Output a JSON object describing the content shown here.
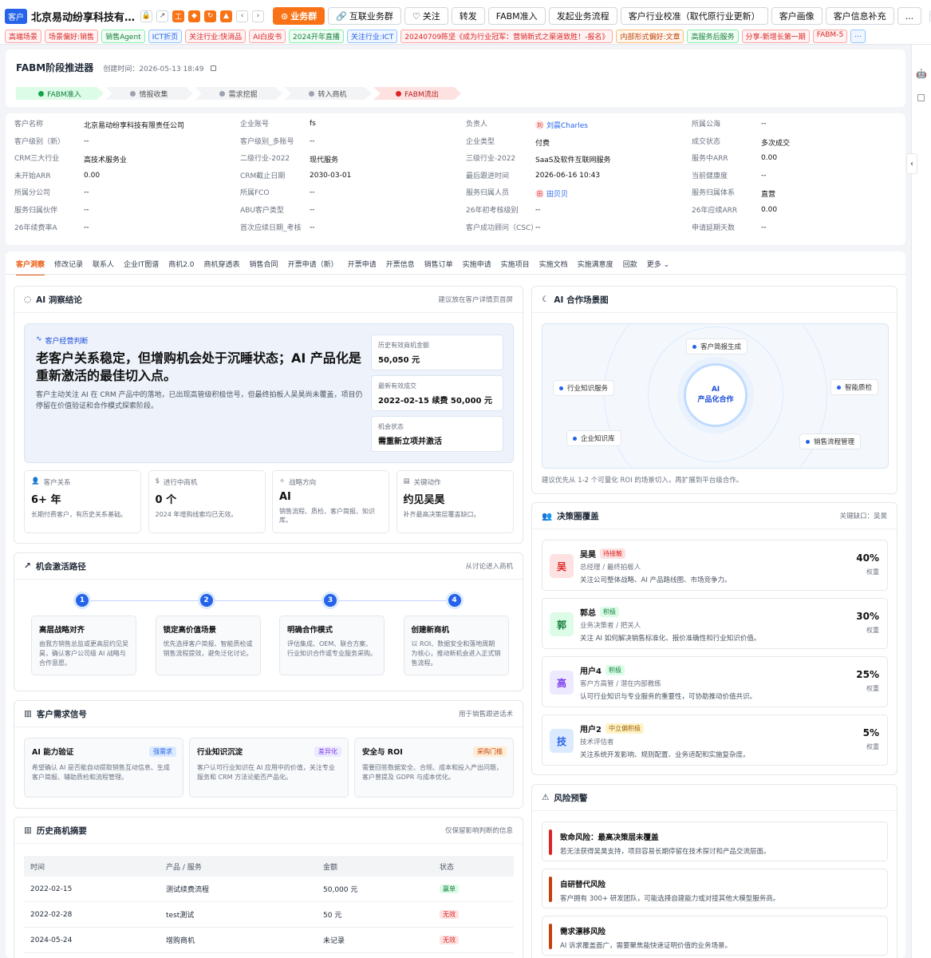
{
  "header": {
    "customer_tag": "客户",
    "company_title": "北京易动纷享科技有限责任公司",
    "icon_labels": [
      "工",
      "◆",
      "↻",
      "▲"
    ],
    "buttons": [
      {
        "label": "业务群",
        "primary": true,
        "icon": "users-icon"
      },
      {
        "label": "互联业务群",
        "icon": "link-icon"
      },
      {
        "label": "关注",
        "icon": "heart-icon"
      },
      {
        "label": "转发"
      },
      {
        "label": "FABM准入"
      },
      {
        "label": "发起业务流程"
      },
      {
        "label": "客户行业校准（取代原行业更新）"
      },
      {
        "label": "客户画像"
      },
      {
        "label": "客户信息补充"
      },
      {
        "label": "..."
      }
    ],
    "tags": [
      {
        "label": "高端场景",
        "c": "r"
      },
      {
        "label": "场景偏好:销售",
        "c": "r"
      },
      {
        "label": "销售Agent",
        "c": "g"
      },
      {
        "label": "ICT折页",
        "c": "b"
      },
      {
        "label": "关注行业:快消品",
        "c": "r"
      },
      {
        "label": "AI白皮书",
        "c": "r"
      },
      {
        "label": "2024开年直播",
        "c": "g"
      },
      {
        "label": "关注行业:ICT",
        "c": "b"
      },
      {
        "label": "20240709陈坚《成为行业冠军：营销新式之渠道致胜！-报名》",
        "c": "r"
      },
      {
        "label": "内部形式偏好:文章",
        "c": "o"
      },
      {
        "label": "高服务后服务",
        "c": "g"
      },
      {
        "label": "分享-新增长第一期",
        "c": "r"
      },
      {
        "label": "FABM-5",
        "c": "r"
      },
      {
        "label": "...",
        "c": "b"
      }
    ]
  },
  "stage": {
    "title": "FABM阶段推进器",
    "created": "创建时间：2026-05-13 18:49",
    "steps": [
      {
        "label": "FABM准入",
        "state": "done"
      },
      {
        "label": "情报收集",
        "state": "todo"
      },
      {
        "label": "需求挖掘",
        "state": "todo"
      },
      {
        "label": "转入商机",
        "state": "todo"
      },
      {
        "label": "FABM流出",
        "state": "out"
      }
    ]
  },
  "info": [
    {
      "label": "客户名称",
      "value": "北京易动纷享科技有限责任公司"
    },
    {
      "label": "企业账号",
      "value": "fs"
    },
    {
      "label": "负责人",
      "value": "刘晨Charles",
      "avatar": "刘",
      "link": true
    },
    {
      "label": "所属公海",
      "value": "--"
    },
    {
      "label": "客户级别（新）",
      "value": "--"
    },
    {
      "label": "客户级别_多账号",
      "value": "--"
    },
    {
      "label": "企业类型",
      "value": "付费"
    },
    {
      "label": "成交状态",
      "value": "多次成交"
    },
    {
      "label": "CRM三大行业",
      "value": "高技术服务业"
    },
    {
      "label": "二级行业-2022",
      "value": "现代服务"
    },
    {
      "label": "三级行业-2022",
      "value": "SaaS及软件互联网服务"
    },
    {
      "label": "服务中ARR",
      "value": "0.00"
    },
    {
      "label": "未开始ARR",
      "value": "0.00"
    },
    {
      "label": "CRM截止日期",
      "value": "2030-03-01"
    },
    {
      "label": "最后跟进时间",
      "value": "2026-06-16 10:43"
    },
    {
      "label": "当前健康度",
      "value": "--"
    },
    {
      "label": "所属分公司",
      "value": "--"
    },
    {
      "label": "所属FCO",
      "value": "--"
    },
    {
      "label": "服务归属人员",
      "value": "田贝贝",
      "avatar": "田",
      "link": true
    },
    {
      "label": "服务归属体系",
      "value": "直营"
    },
    {
      "label": "服务归属伙伴",
      "value": "--"
    },
    {
      "label": "ABU客户类型",
      "value": "--"
    },
    {
      "label": "26年初考核级别",
      "value": "--"
    },
    {
      "label": "26年应续ARR",
      "value": "0.00"
    },
    {
      "label": "26年续费率A",
      "value": "--"
    },
    {
      "label": "首次应续日期_考核",
      "value": "--"
    },
    {
      "label": "客户成功顾问（CSC）",
      "value": "--"
    },
    {
      "label": "申请延期天数",
      "value": "--"
    }
  ],
  "tabs": [
    "客户洞察",
    "修改记录",
    "联系人",
    "企业IT图谱",
    "商机2.0",
    "商机穿透表",
    "销售合同",
    "开票申请（新）",
    "开票申请",
    "开票信息",
    "销售订单",
    "实施申请",
    "实施项目",
    "实施文档",
    "实施满意度",
    "回款",
    "更多"
  ],
  "ai": {
    "title": "AI 洞察结论",
    "note": "建议放在客户详情页首屏",
    "tag": "客户经营判断",
    "headline": "老客户关系稳定，但增购机会处于沉睡状态；AI 产品化是重新激活的最佳切入点。",
    "desc": "客户主动关注 AI 在 CRM 产品中的落地，已出现高管级积极信号，但最终拍板人吴昊尚未覆盖，项目仍停留在价值验证和合作模式探索阶段。",
    "kvs": [
      {
        "k": "历史有效商机金额",
        "v": "50,050 元"
      },
      {
        "k": "最新有效成交",
        "v": "2022-02-15 续费 50,000 元"
      },
      {
        "k": "机会状态",
        "v": "需重新立项并激活"
      }
    ],
    "stats": [
      {
        "k": "客户关系",
        "v": "6+ 年",
        "d": "长期付费客户，有历史关系基础。",
        "icon": "user-icon"
      },
      {
        "k": "进行中商机",
        "v": "0 个",
        "d": "2024 年增购线索均已无效。",
        "icon": "dollar-icon"
      },
      {
        "k": "战略方向",
        "v": "AI",
        "d": "销售流程、质检、客户简报、知识库。",
        "icon": "sparkle-icon"
      },
      {
        "k": "关键动作",
        "v": "约见吴昊",
        "d": "补齐最高决策层覆盖缺口。",
        "icon": "doc-icon"
      }
    ]
  },
  "path": {
    "title": "机会激活路径",
    "note": "从讨论进入商机",
    "steps": [
      {
        "n": "1",
        "t": "高层战略对齐",
        "d": "由我方销售总监或更高层约见吴昊，确认客户公司级 AI 战略与合作意愿。"
      },
      {
        "n": "2",
        "t": "锁定高价值场景",
        "d": "优先选择客户简报、智能质检或销售流程提效，避免泛化讨论。"
      },
      {
        "n": "3",
        "t": "明确合作模式",
        "d": "评估集成、OEM、联合方案、行业知识合作或专业服务采购。"
      },
      {
        "n": "4",
        "t": "创建新商机",
        "d": "以 ROI、数据安全和落地周期为核心，推动新机会进入正式销售流程。"
      }
    ]
  },
  "signals": {
    "title": "客户需求信号",
    "note": "用于销售跟进话术",
    "items": [
      {
        "t": "AI 能力验证",
        "b": "强需求",
        "bc": "#2563eb",
        "bb": "#dbeafe",
        "d": "希望确认 AI 是否能自动提取销售互动信息、生成客户简报、辅助质检和流程管理。"
      },
      {
        "t": "行业知识沉淀",
        "b": "差异化",
        "bc": "#7c3aed",
        "bb": "#ede9fe",
        "d": "客户认可行业知识在 AI 应用中的价值，关注专业服务和 CRM 方法论能否产品化。"
      },
      {
        "t": "安全与 ROI",
        "b": "采购门槛",
        "bc": "#c2410c",
        "bb": "#ffedd5",
        "d": "需要回答数据安全、合规、成本和投入产出问题，客户曾提及 GDPR 与成本优化。"
      }
    ]
  },
  "history": {
    "title": "历史商机摘要",
    "note": "仅保留影响判断的信息",
    "head": [
      "时间",
      "产品 / 服务",
      "金额",
      "状态"
    ],
    "rows": [
      {
        "t": "2022-02-15",
        "p": "测试续费流程",
        "a": "50,000 元",
        "s": "赢单",
        "ok": true
      },
      {
        "t": "2022-02-28",
        "p": "test測试",
        "a": "50 元",
        "s": "无效",
        "ok": false
      },
      {
        "t": "2024-05-24",
        "p": "增购商机",
        "a": "未记录",
        "s": "无效",
        "ok": false
      }
    ]
  },
  "scene": {
    "title": "AI 合作场景图",
    "core": "AI",
    "core2": "产品化合作",
    "nodes": [
      "客户简报生成",
      "智能质检",
      "销售流程管理",
      "企业知识库",
      "行业知识服务"
    ],
    "note": "建议优先从 1-2 个可量化 ROI 的场景切入，再扩展到平台级合作。"
  },
  "decision": {
    "title": "决策圈覆盖",
    "note": "关键缺口：吴昊",
    "weight_label": "权重",
    "members": [
      {
        "av": "吴",
        "c": "#dc2626",
        "bg": "#fee2e2",
        "name": "吴昊",
        "badge": "待接触",
        "bc": "#dc2626",
        "bb": "#fee2e2",
        "role": "总经理 / 最终拍板人",
        "desc": "关注公司整体战略、AI 产品路线图、市场竞争力。",
        "pct": "40%"
      },
      {
        "av": "郭",
        "c": "#15803d",
        "bg": "#dcfce7",
        "name": "郭总",
        "badge": "积极",
        "bc": "#15803d",
        "bb": "#dcfce7",
        "role": "业务决策者 / 把关人",
        "desc": "关注 AI 如何解决销售标准化、报价准确性和行业知识价值。",
        "pct": "30%"
      },
      {
        "av": "高",
        "c": "#7c3aed",
        "bg": "#ede9fe",
        "name": "用户4",
        "badge": "积极",
        "bc": "#15803d",
        "bb": "#dcfce7",
        "role": "客户方高管 / 潜在内部教练",
        "desc": "认可行业知识与专业服务的重要性，可协助推动价值共识。",
        "pct": "25%"
      },
      {
        "av": "技",
        "c": "#2563eb",
        "bg": "#dbeafe",
        "name": "用户2",
        "badge": "中立偏积极",
        "bc": "#a16207",
        "bb": "#fef3c7",
        "role": "技术评估者",
        "desc": "关注系统开发影响、规则配置、业务适配和实施复杂度。",
        "pct": "5%"
      }
    ]
  },
  "risk": {
    "title": "风险预警",
    "items": [
      {
        "t": "致命风险：最高决策层未覆盖",
        "d": "若无法获得吴昊支持，项目容易长期停留在技术探讨和产品交流层面。",
        "c": "#dc2626"
      },
      {
        "t": "自研替代风险",
        "d": "客户拥有 300+ 研发团队，可能选择自建能力或对接其他大模型服务商。",
        "c": "#c2410c"
      },
      {
        "t": "需求漂移风险",
        "d": "AI 诉求覆盖面广，需要聚焦能快速证明价值的业务场景。",
        "c": "#c2410c"
      }
    ]
  }
}
